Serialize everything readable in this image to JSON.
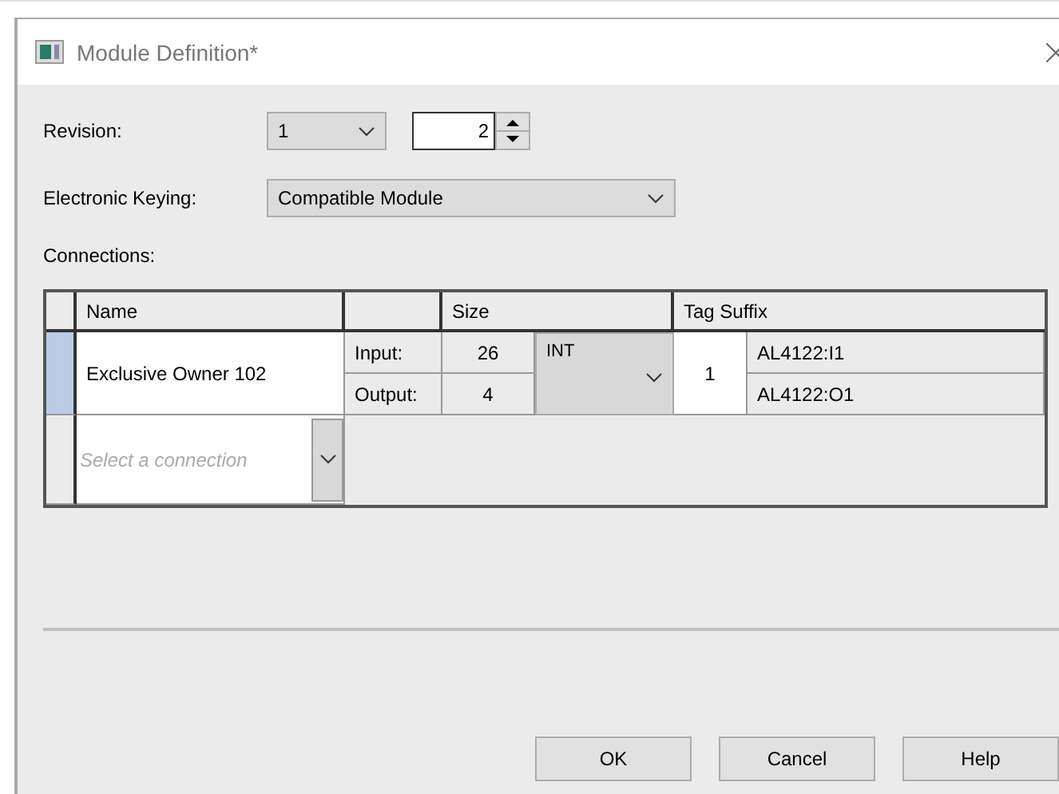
{
  "window": {
    "title": "Module Definition*"
  },
  "revision": {
    "label": "Revision:",
    "major": "1",
    "minor": "2"
  },
  "keying": {
    "label": "Electronic Keying:",
    "value": "Compatible Module"
  },
  "connections": {
    "label": "Connections:",
    "columns": [
      "Name",
      "Size",
      "Tag Suffix"
    ],
    "rows": [
      {
        "name": "Exclusive Owner 102",
        "selected": true,
        "input_label": "Input:",
        "input_size": "26",
        "output_label": "Output:",
        "output_size": "4",
        "data_type": "INT",
        "suffix_number": "1",
        "input_tag": "AL4122:I1",
        "output_tag": "AL4122:O1"
      }
    ],
    "new_row": {
      "placeholder": "Select a connection"
    }
  },
  "buttons": [
    "OK",
    "Cancel",
    "Help"
  ]
}
